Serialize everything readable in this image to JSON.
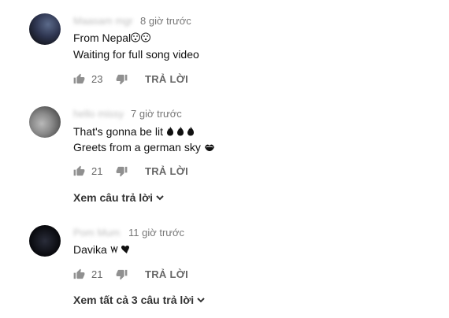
{
  "comments": [
    {
      "author": "Maasam mgr",
      "time": "8 giờ trước",
      "lines": [
        "From Nepal",
        "Waiting for full song video"
      ],
      "likes": "23",
      "reply_label": "TRẢ LỜI"
    },
    {
      "author": "hello missy",
      "time": "7 giờ trước",
      "lines": [
        "That's gonna be lit",
        "Greets from a german sky"
      ],
      "likes": "21",
      "reply_label": "TRẢ LỜI",
      "view_replies": "Xem câu trả lời"
    },
    {
      "author": "Pom Mum",
      "time": "11 giờ trước",
      "lines": [
        "Davika"
      ],
      "likes": "21",
      "reply_label": "TRẢ LỜI",
      "view_replies": "Xem tất cả 3 câu trả lời"
    }
  ],
  "icons": {
    "like": "thumbs-up-icon",
    "dislike": "thumbs-down-icon",
    "chevron": "chevron-down-icon"
  }
}
